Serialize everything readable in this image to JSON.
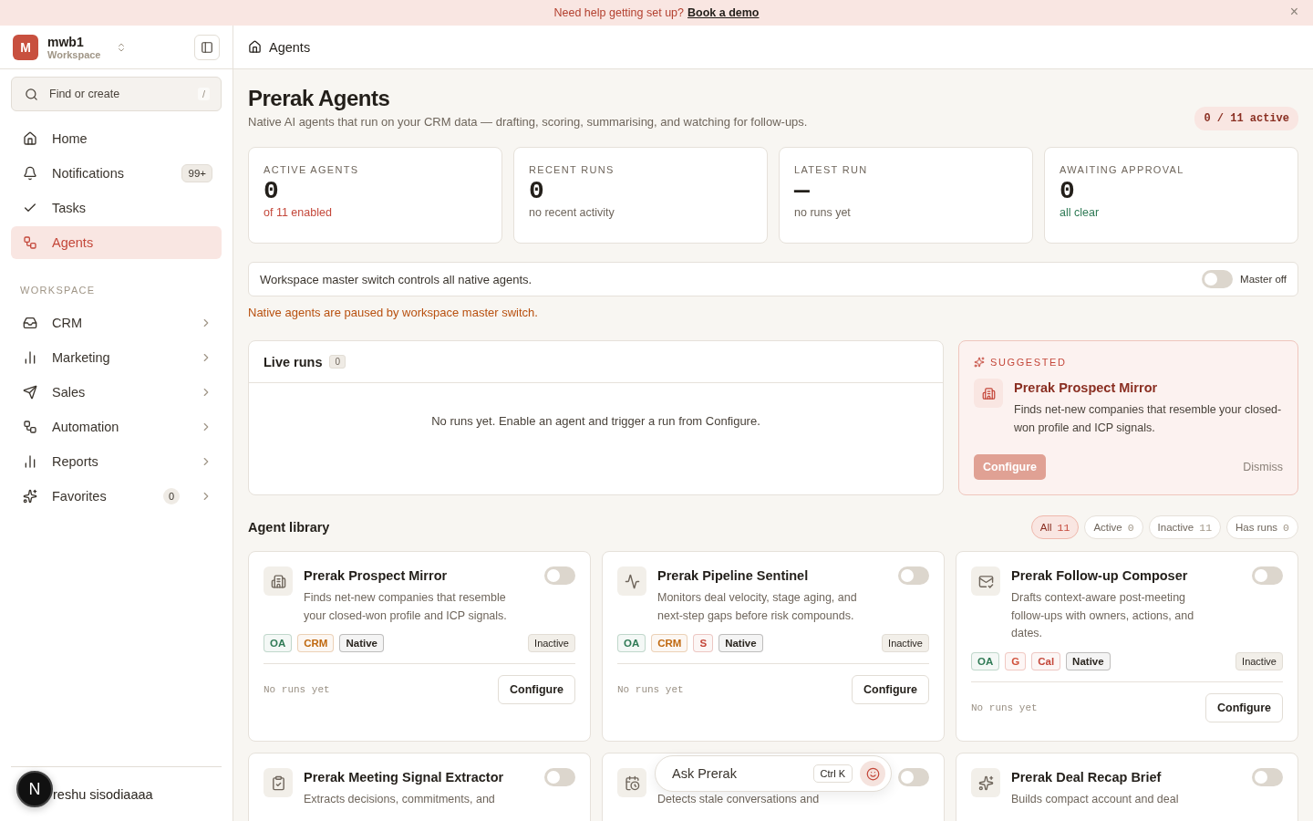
{
  "banner": {
    "text": "Need help getting set up?",
    "link": "Book a demo",
    "close": "×"
  },
  "workspace": {
    "initial": "M",
    "name": "mwb1",
    "subtitle": "Workspace"
  },
  "search": {
    "placeholder": "Find or create",
    "shortcut": "/"
  },
  "nav": [
    {
      "label": "Home",
      "selected": false
    },
    {
      "label": "Notifications",
      "badge": "99+",
      "selected": false
    },
    {
      "label": "Tasks",
      "selected": false
    },
    {
      "label": "Agents",
      "selected": true
    }
  ],
  "workspace_section": {
    "title": "WORKSPACE",
    "items": [
      {
        "label": "CRM",
        "expandable": true
      },
      {
        "label": "Marketing",
        "expandable": true
      },
      {
        "label": "Sales",
        "expandable": true
      },
      {
        "label": "Automation",
        "expandable": true
      },
      {
        "label": "Reports",
        "expandable": true
      },
      {
        "label": "Favorites",
        "badge": "0",
        "expandable": true
      }
    ]
  },
  "user": {
    "name": "reshu sisodiaaaa",
    "dev_badge": "N"
  },
  "breadcrumb": "Agents",
  "page": {
    "title": "Prerak Agents",
    "subtitle": "Native AI agents that run on your CRM data — drafting, scoring, summarising, and watching for follow-ups.",
    "active_pill": "0 / 11 active"
  },
  "stats": [
    {
      "label": "ACTIVE AGENTS",
      "value": "0",
      "note": "of 11 enabled",
      "color": "#c4473a"
    },
    {
      "label": "RECENT RUNS",
      "value": "0",
      "note": "no recent activity",
      "color": "#6f665c"
    },
    {
      "label": "LATEST RUN",
      "value": "—",
      "note": "no runs yet",
      "color": "#6f665c"
    },
    {
      "label": "AWAITING APPROVAL",
      "value": "0",
      "note": "all clear",
      "color": "#2f7a55"
    }
  ],
  "master": {
    "text": "Workspace master switch controls all native agents.",
    "on": false,
    "label": "Master off",
    "notice": "Native agents are paused by workspace master switch."
  },
  "live_runs": {
    "title": "Live runs",
    "count": "0",
    "empty": "No runs yet. Enable an agent and trigger a run from Configure."
  },
  "suggested": {
    "label": "SUGGESTED",
    "title": "Prerak Prospect Mirror",
    "description": "Finds net-new companies that resemble your closed-won profile and ICP signals.",
    "primary": "Configure",
    "secondary": "Dismiss"
  },
  "library": {
    "title": "Agent library",
    "filters": [
      {
        "label": "All",
        "count": "11",
        "selected": true
      },
      {
        "label": "Active",
        "count": "0",
        "selected": false
      },
      {
        "label": "Inactive",
        "count": "11",
        "selected": false
      },
      {
        "label": "Has runs",
        "count": "0",
        "selected": false
      }
    ]
  },
  "agents": [
    {
      "title": "Prerak Prospect Mirror",
      "description": "Finds net-new companies that resemble your closed-won profile and ICP signals.",
      "on": false,
      "tags": [
        {
          "label": "OA",
          "color": "#2f7a55"
        },
        {
          "label": "CRM",
          "color": "#c0680f"
        },
        {
          "label": "Native",
          "color": "#2b2620"
        }
      ],
      "status": "Inactive",
      "runs": "No runs yet",
      "action": "Configure"
    },
    {
      "title": "Prerak Pipeline Sentinel",
      "description": "Monitors deal velocity, stage aging, and next-step gaps before risk compounds.",
      "on": false,
      "tags": [
        {
          "label": "OA",
          "color": "#2f7a55"
        },
        {
          "label": "CRM",
          "color": "#c0680f"
        },
        {
          "label": "S",
          "color": "#c4473a"
        },
        {
          "label": "Native",
          "color": "#2b2620"
        }
      ],
      "status": "Inactive",
      "runs": "No runs yet",
      "action": "Configure"
    },
    {
      "title": "Prerak Follow-up Composer",
      "description": "Drafts context-aware post-meeting follow-ups with owners, actions, and dates.",
      "on": false,
      "tags": [
        {
          "label": "OA",
          "color": "#2f7a55"
        },
        {
          "label": "G",
          "color": "#d0503a"
        },
        {
          "label": "Cal",
          "color": "#c4473a"
        },
        {
          "label": "Native",
          "color": "#2b2620"
        }
      ],
      "status": "Inactive",
      "runs": "No runs yet",
      "action": "Configure"
    },
    {
      "title": "Prerak Meeting Signal Extractor",
      "description": "Extracts decisions, commitments, and",
      "on": false
    },
    {
      "description": "Detects stale conversations and",
      "on": false
    },
    {
      "title": "Prerak Deal Recap Brief",
      "description": "Builds compact account and deal",
      "on": false
    }
  ],
  "assistant": {
    "placeholder": "Ask Prerak",
    "shortcut": "Ctrl K"
  }
}
